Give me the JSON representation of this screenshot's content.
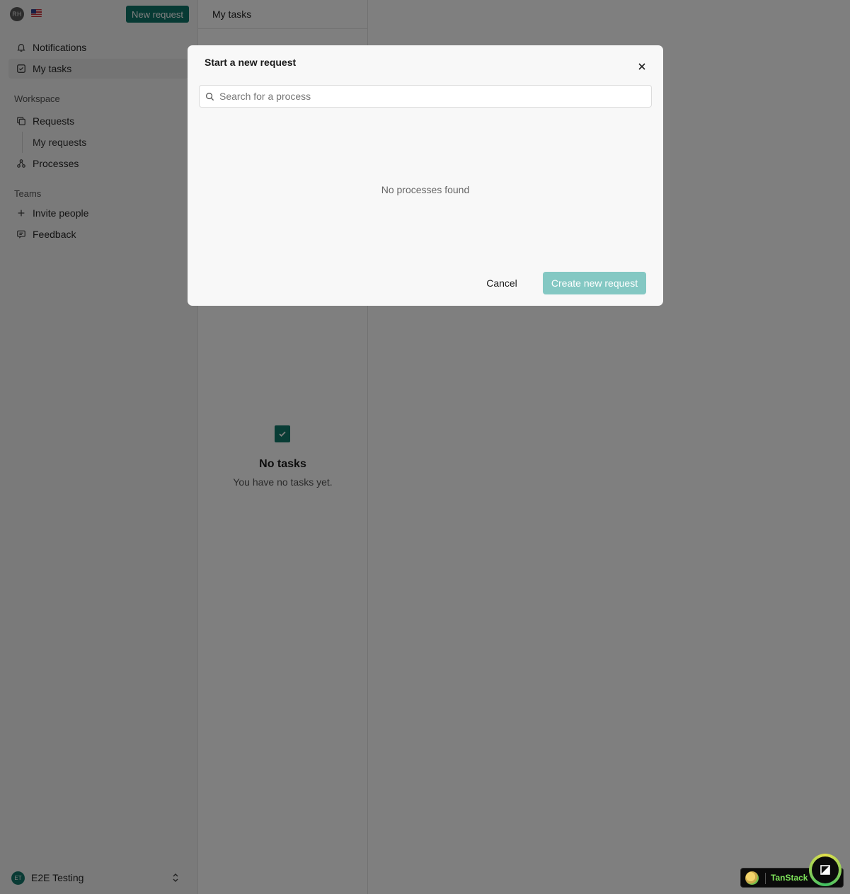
{
  "app": {
    "user_initials": "RH",
    "new_request_label": "New request",
    "brand_color": "#0f7468"
  },
  "sidebar": {
    "nav": [
      {
        "label": "Notifications",
        "icon": "bell-icon"
      },
      {
        "label": "My tasks",
        "icon": "checkbox-icon",
        "active": true
      }
    ],
    "workspace": {
      "heading": "Workspace",
      "requests_label": "Requests",
      "my_requests_label": "My requests",
      "processes_label": "Processes"
    },
    "teams": {
      "heading": "Teams",
      "invite_label": "Invite people",
      "feedback_label": "Feedback"
    },
    "footer": {
      "workspace_initials": "ET",
      "workspace_name": "E2E Testing"
    }
  },
  "panel": {
    "title": "My tasks",
    "empty_title": "No tasks",
    "empty_subtitle": "You have no tasks yet."
  },
  "modal": {
    "title": "Start a new request",
    "search_placeholder": "Search for a process",
    "search_value": "",
    "empty_message": "No processes found",
    "cancel_label": "Cancel",
    "create_label": "Create new request",
    "create_disabled": true
  },
  "devtools": {
    "label": "TanStack"
  }
}
